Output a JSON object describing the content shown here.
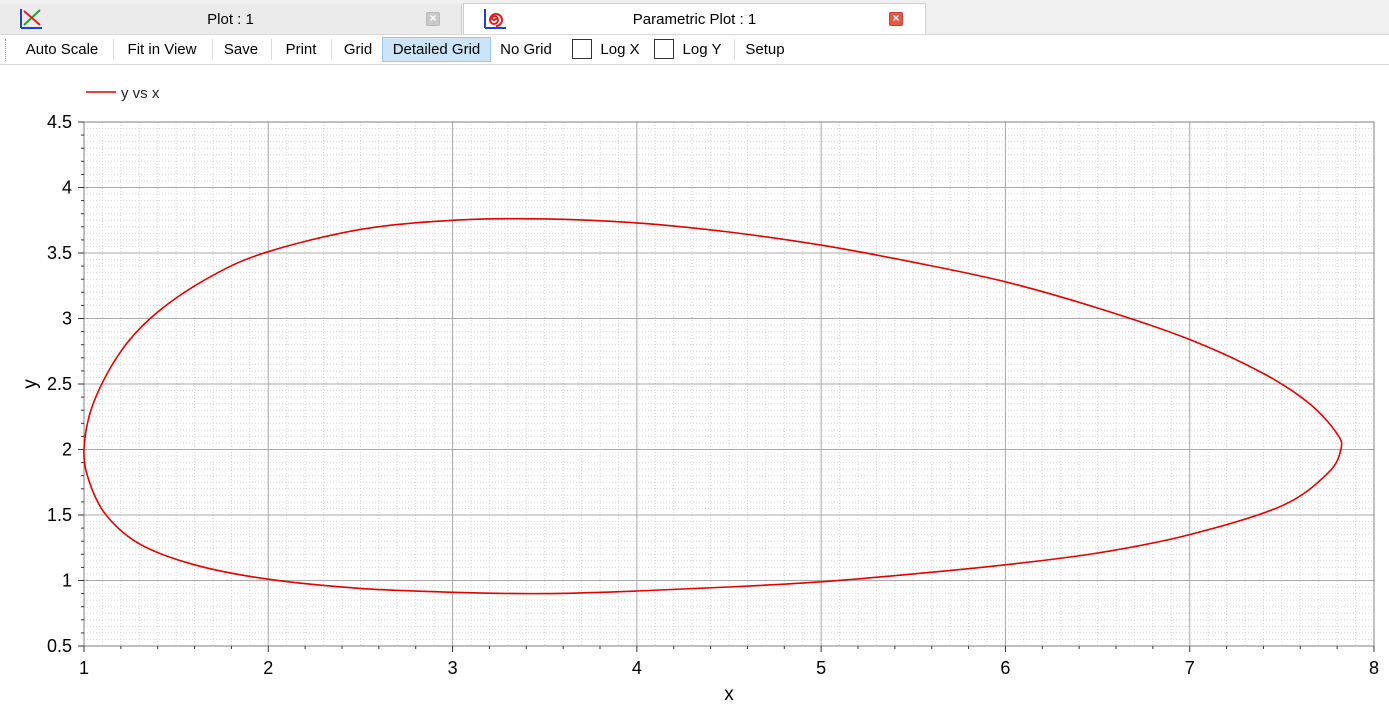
{
  "tabs": [
    {
      "label": "Plot : 1",
      "icon": "line-plot-icon",
      "active": false
    },
    {
      "label": "Parametric Plot : 1",
      "icon": "parametric-spiral-icon",
      "active": true
    }
  ],
  "toolbar": {
    "auto_scale": "Auto Scale",
    "fit_in_view": "Fit in View",
    "save": "Save",
    "print": "Print",
    "grid": "Grid",
    "detailed_grid": "Detailed Grid",
    "no_grid": "No Grid",
    "log_x": "Log X",
    "log_x_checked": false,
    "log_y": "Log Y",
    "log_y_checked": false,
    "setup": "Setup",
    "selected_grid_mode": "Detailed Grid"
  },
  "colors": {
    "series": "#e00000",
    "grid_major": "#a8a8a8",
    "grid_minor": "#d4d4d4",
    "active_button": "#cce4f7"
  },
  "chart_data": {
    "type": "line",
    "legend": [
      "y vs x"
    ],
    "legend_position": "top-left",
    "xlabel": "x",
    "ylabel": "y",
    "xlim": [
      1,
      8
    ],
    "ylim": [
      0.5,
      4.5
    ],
    "xticks": [
      "1",
      "2",
      "3",
      "4",
      "5",
      "6",
      "7",
      "8"
    ],
    "yticks": [
      "0.5",
      "1",
      "1.5",
      "2",
      "2.5",
      "3",
      "3.5",
      "4",
      "4.5"
    ],
    "grid": "detailed",
    "series": [
      {
        "name": "y vs x",
        "x": [
          1.0,
          1.05,
          1.2,
          1.4,
          1.7,
          2.0,
          2.5,
          3.0,
          3.5,
          4.0,
          4.5,
          5.0,
          5.5,
          6.0,
          6.5,
          7.0,
          7.4,
          7.65,
          7.8,
          7.82,
          7.75,
          7.5,
          7.0,
          6.5,
          6.0,
          5.5,
          5.0,
          4.5,
          4.0,
          3.5,
          3.0,
          2.5,
          2.0,
          1.6,
          1.3,
          1.12,
          1.03,
          1.0
        ],
        "y": [
          2.0,
          2.35,
          2.75,
          3.05,
          3.33,
          3.51,
          3.68,
          3.75,
          3.76,
          3.73,
          3.66,
          3.56,
          3.43,
          3.28,
          3.08,
          2.84,
          2.58,
          2.35,
          2.12,
          2.0,
          1.82,
          1.57,
          1.35,
          1.21,
          1.12,
          1.05,
          0.99,
          0.95,
          0.92,
          0.9,
          0.91,
          0.94,
          1.01,
          1.12,
          1.28,
          1.5,
          1.75,
          2.0
        ]
      }
    ]
  }
}
